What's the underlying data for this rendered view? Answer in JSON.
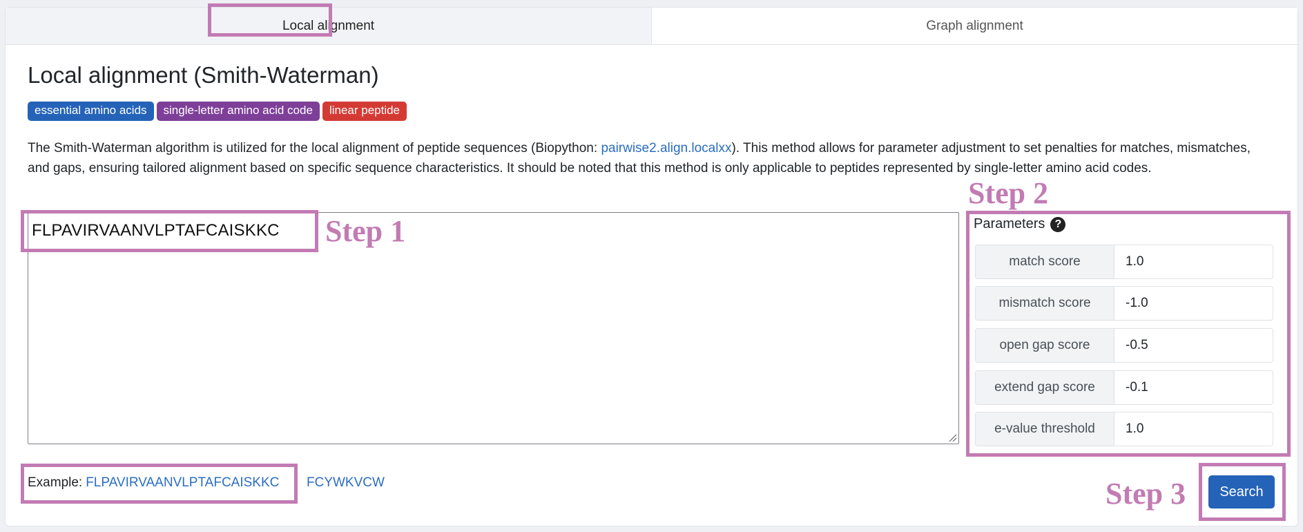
{
  "tabs": [
    {
      "label": "Local alignment",
      "active": true
    },
    {
      "label": "Graph alignment",
      "active": false
    }
  ],
  "page": {
    "title": "Local alignment (Smith-Waterman)",
    "badges": [
      {
        "label": "essential amino acids",
        "color": "#2463b8"
      },
      {
        "label": "single-letter amino acid code",
        "color": "#7d3f98"
      },
      {
        "label": "linear peptide",
        "color": "#d43a34"
      }
    ],
    "description_before": "The Smith-Waterman algorithm is utilized for the local alignment of peptide sequences (Biopython: ",
    "description_link": "pairwise2.align.localxx",
    "description_after": "). This method allows for parameter adjustment to set penalties for matches, mismatches, and gaps, ensuring tailored alignment based on specific sequence characteristics. It should be noted that this method is only applicable to peptides represented by single-letter amino acid codes."
  },
  "sequence_input": {
    "value": "FLPAVIRVAANVLPTAFCAISKKC"
  },
  "parameters": {
    "label": "Parameters",
    "help_icon": "?",
    "rows": [
      {
        "name": "match score",
        "value": "1.0"
      },
      {
        "name": "mismatch score",
        "value": "-1.0"
      },
      {
        "name": "open gap score",
        "value": "-0.5"
      },
      {
        "name": "extend gap score",
        "value": "-0.1"
      },
      {
        "name": "e-value threshold",
        "value": "1.0"
      }
    ]
  },
  "examples": {
    "label": "Example:",
    "items": [
      "FLPAVIRVAANVLPTAFCAISKKC",
      "FCYWKVCW"
    ]
  },
  "search_button": {
    "label": "Search"
  },
  "annotations": {
    "step1": "Step 1",
    "step2": "Step 2",
    "step3": "Step 3",
    "color": "#c27bb3"
  }
}
